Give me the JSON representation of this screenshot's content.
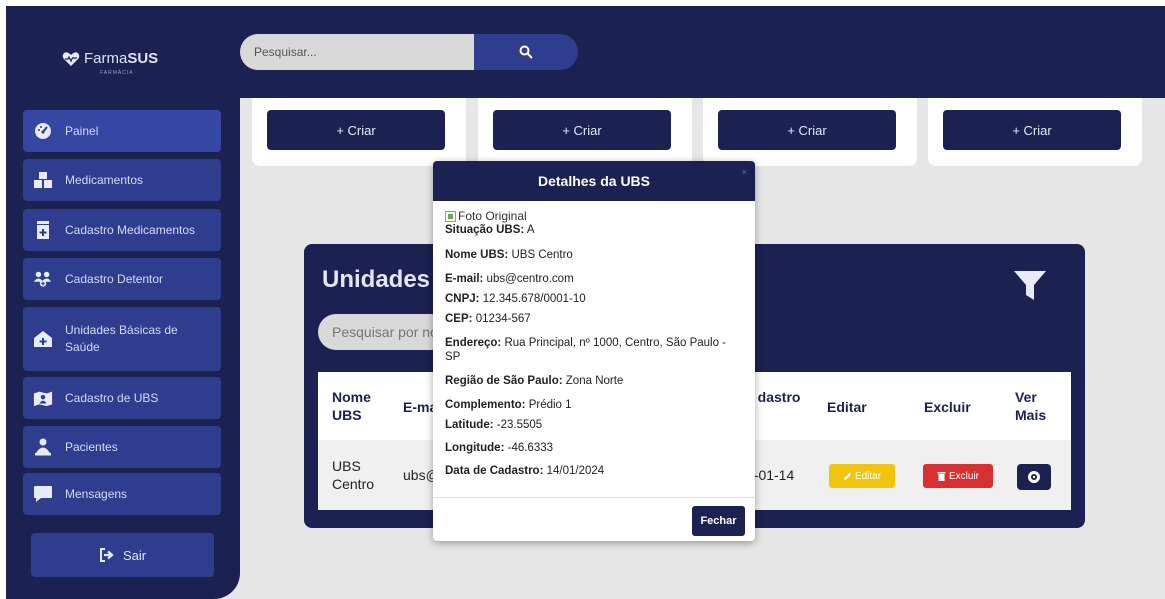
{
  "brand": {
    "logo_text_light": "Farma",
    "logo_text_bold": "SUS",
    "logo_sub": "FARMÁCIA"
  },
  "search": {
    "placeholder": "Pesquisar..."
  },
  "sidebar": {
    "items": [
      {
        "label": "Painel",
        "icon": "dashboard-gauge-icon"
      },
      {
        "label": "Medicamentos",
        "icon": "boxes-icon"
      },
      {
        "label": "Cadastro Medicamentos",
        "icon": "medicine-add-icon"
      },
      {
        "label": "Cadastro Detentor",
        "icon": "users-add-icon"
      },
      {
        "label": "Unidades Básicas de Saúde",
        "icon": "clinic-icon"
      },
      {
        "label": "Cadastro de UBS",
        "icon": "map-user-icon"
      },
      {
        "label": "Pacientes",
        "icon": "patient-icon"
      },
      {
        "label": "Mensagens",
        "icon": "chat-icon"
      }
    ],
    "exit_label": "Sair"
  },
  "cards": {
    "create_label": "+ Criar"
  },
  "units_panel": {
    "title": "Unidades",
    "filter_placeholder": "Pesquisar por no",
    "headers": {
      "nome": "Nome UBS",
      "email": "E-ma",
      "data": "a dastro",
      "editar": "Editar",
      "excluir": "Excluir",
      "ver": "Ver Mais"
    },
    "row": {
      "nome": "UBS Centro",
      "email": "ubs@",
      "data": "4-01-14",
      "edit_label": "Editar",
      "delete_label": "Excluir"
    }
  },
  "modal": {
    "title": "Detalhes da UBS",
    "close_x": "×",
    "image_alt": "Foto Original",
    "fields": [
      {
        "label": "Situação UBS:",
        "value": "A"
      },
      {
        "label": "Nome UBS:",
        "value": "UBS Centro"
      },
      {
        "label": "E-mail:",
        "value": "ubs@centro.com"
      },
      {
        "label": "CNPJ:",
        "value": "12.345.678/0001-10"
      },
      {
        "label": "CEP:",
        "value": "01234-567"
      },
      {
        "label": "Endereço:",
        "value": "Rua Principal, nº 1000, Centro, São Paulo - SP"
      },
      {
        "label": "Região de São Paulo:",
        "value": "Zona Norte"
      },
      {
        "label": "Complemento:",
        "value": "Prédio 1"
      },
      {
        "label": "Latitude:",
        "value": "-23.5505"
      },
      {
        "label": "Longitude:",
        "value": "-46.6333"
      },
      {
        "label": "Data de Cadastro:",
        "value": "14/01/2024"
      }
    ],
    "close_label": "Fechar"
  },
  "colors": {
    "navy": "#1b2150",
    "sidebar_button": "#2e3d8e",
    "edit": "#f1c40f",
    "delete": "#d63031"
  }
}
